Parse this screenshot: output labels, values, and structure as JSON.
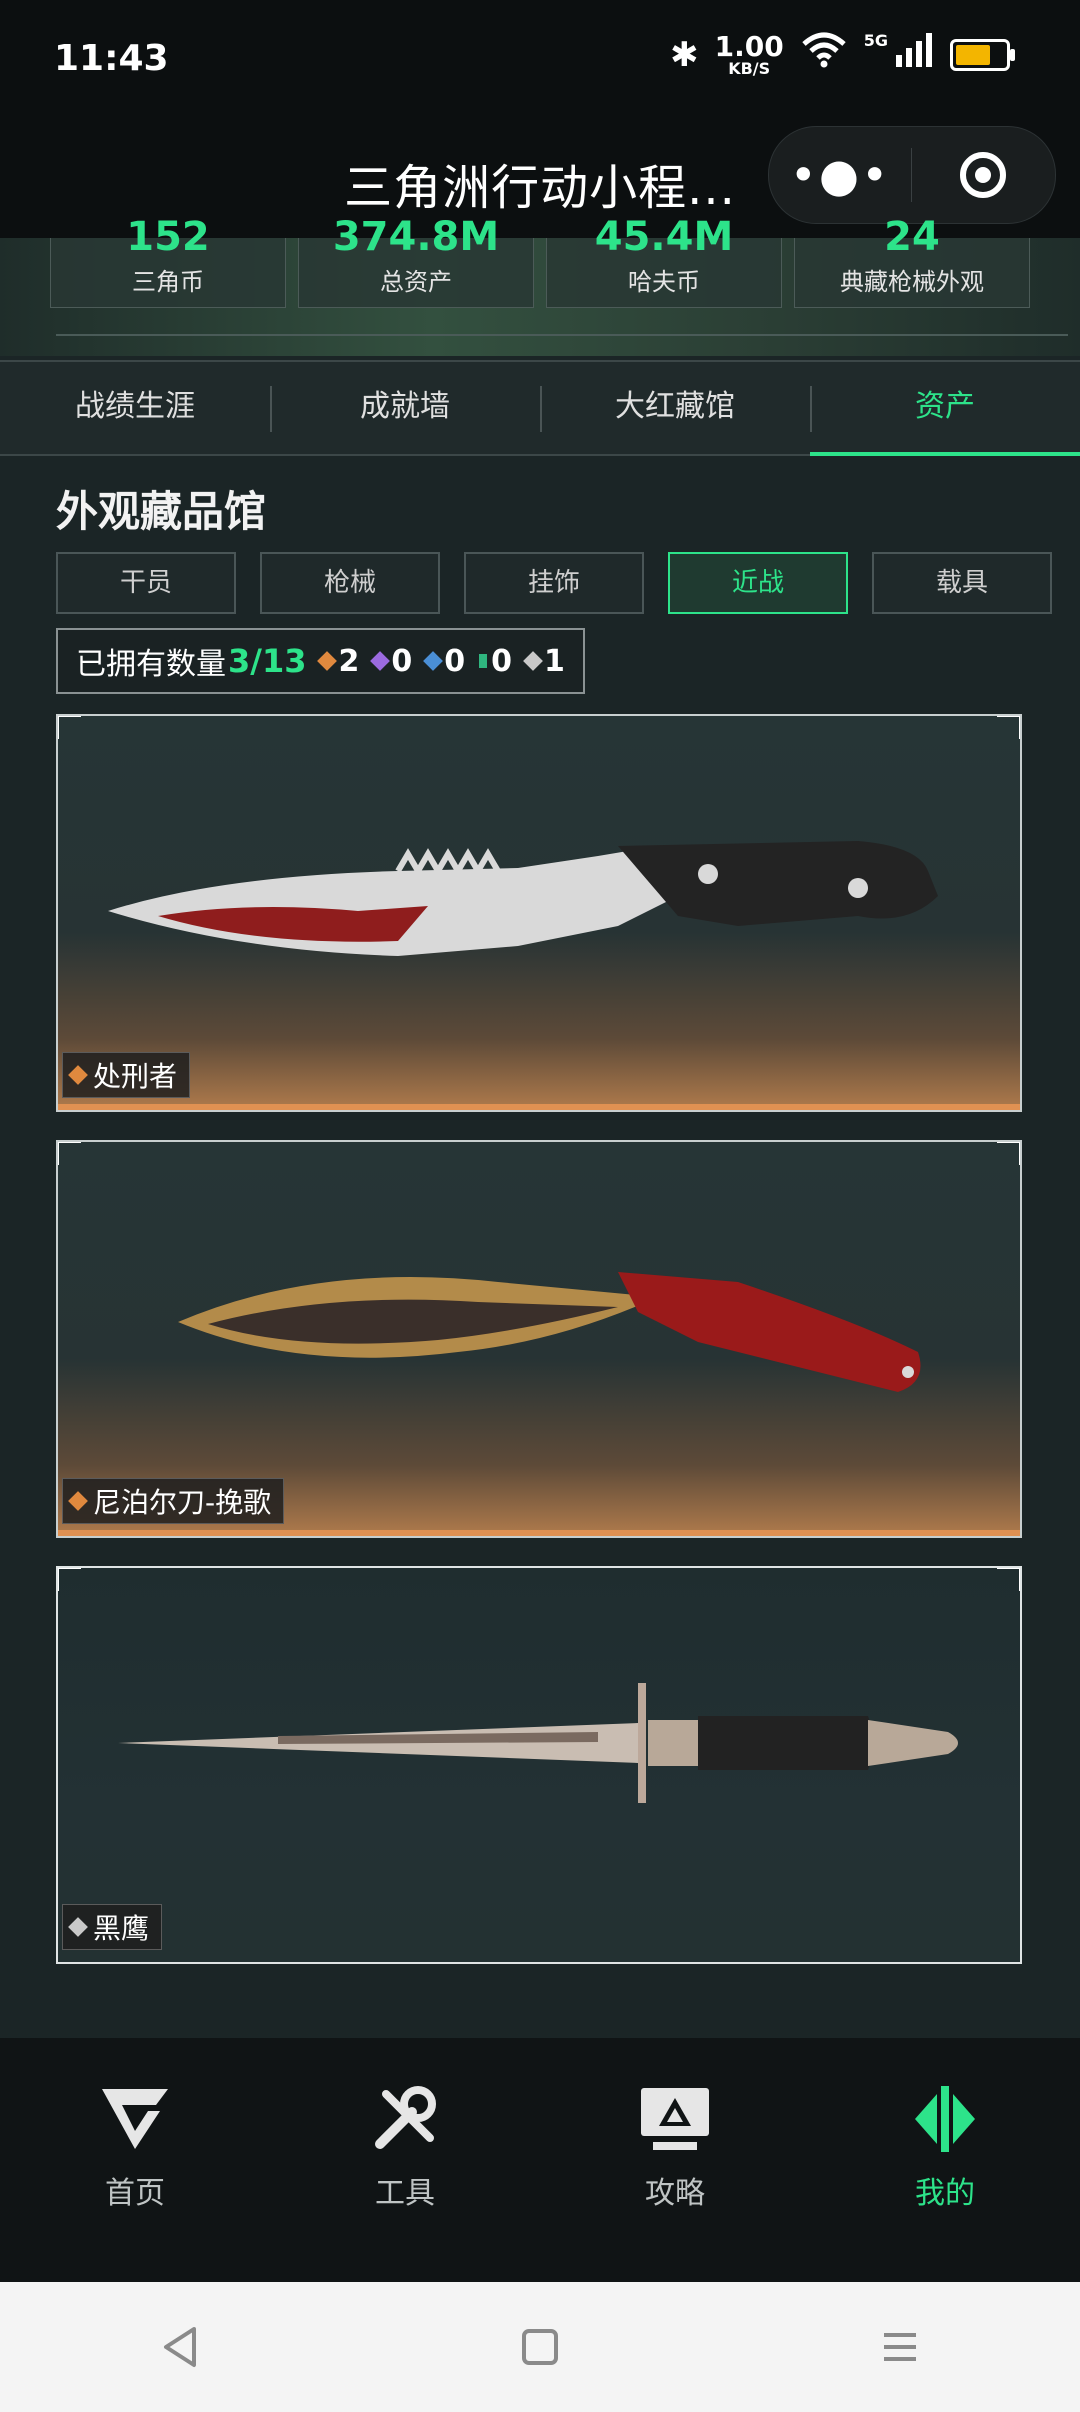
{
  "status_bar": {
    "time": "11:43",
    "speed_value": "1.00",
    "speed_unit": "KB/S",
    "network": "5G",
    "battery_color": "#f3b500"
  },
  "title_bar": {
    "title": "三角洲行动小程...",
    "more_icon": "more-dots-icon",
    "close_icon": "target-icon"
  },
  "stats": [
    {
      "value": "152",
      "label": "三角币"
    },
    {
      "value": "374.8M",
      "label": "总资产"
    },
    {
      "value": "45.4M",
      "label": "哈夫币"
    },
    {
      "value": "24",
      "label": "典藏枪械外观"
    }
  ],
  "tabs": [
    {
      "label": "战绩生涯",
      "active": false
    },
    {
      "label": "成就墙",
      "active": false
    },
    {
      "label": "大红藏馆",
      "active": false
    },
    {
      "label": "资产",
      "active": true
    }
  ],
  "section": {
    "title": "外观藏品馆",
    "categories": [
      {
        "label": "干员",
        "active": false
      },
      {
        "label": "枪械",
        "active": false
      },
      {
        "label": "挂饰",
        "active": false
      },
      {
        "label": "近战",
        "active": true
      },
      {
        "label": "载具",
        "active": false
      }
    ],
    "owned": {
      "label": "已拥有数量",
      "count": "3/13",
      "rarities": [
        {
          "color": "#e0893e",
          "value": "2"
        },
        {
          "color": "#9b6be0",
          "value": "0"
        },
        {
          "color": "#4a8fd6",
          "value": "0"
        },
        {
          "color": "#2fb67f",
          "value": "0"
        },
        {
          "color": "#c9c9c9",
          "value": "1"
        }
      ]
    }
  },
  "items": [
    {
      "name": "处刑者",
      "rarity_color": "#e0893e"
    },
    {
      "name": "尼泊尔刀-挽歌",
      "rarity_color": "#e0893e"
    },
    {
      "name": "黑鹰",
      "rarity_color": "#c9c9c9"
    }
  ],
  "bottom_nav": [
    {
      "label": "首页",
      "icon": "home-logo-icon",
      "active": false
    },
    {
      "label": "工具",
      "icon": "tools-icon",
      "active": false
    },
    {
      "label": "攻略",
      "icon": "guide-monitor-icon",
      "active": false
    },
    {
      "label": "我的",
      "icon": "profile-logo-icon",
      "active": true
    }
  ],
  "accent_color": "#2de38a"
}
